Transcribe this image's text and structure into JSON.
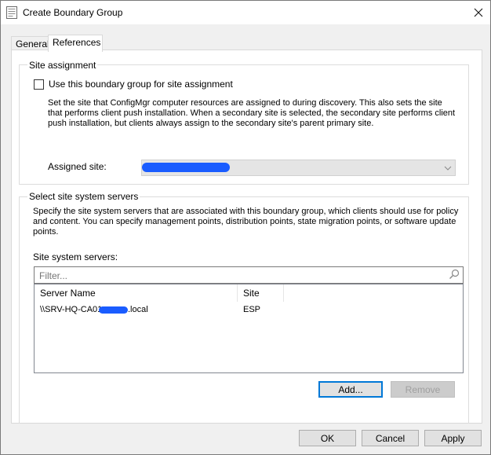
{
  "window": {
    "title": "Create Boundary Group"
  },
  "tabs": [
    {
      "label": "General"
    },
    {
      "label": "References"
    }
  ],
  "site_assignment": {
    "group_label": "Site assignment",
    "checkbox_label": "Use this boundary group for site assignment",
    "checked": false,
    "description": "Set the site that ConfigMgr computer resources are assigned to during discovery. This also sets the site that performs client push installation. When a secondary site is selected, the secondary site performs client push installation, but clients always assign to the secondary site's parent primary site.",
    "assigned_site_label": "Assigned site:",
    "assigned_site_value": ""
  },
  "site_system": {
    "group_label": "Select site system servers",
    "description": "Specify the site system servers that are associated with this boundary group, which clients should use for policy and content. You can specify management points, distribution points, state migration points, or software update points.",
    "servers_label": "Site system servers:",
    "filter_placeholder": "Filter...",
    "columns": [
      "Server Name",
      "Site"
    ],
    "rows": [
      {
        "server_prefix": "\\\\SRV-HQ-CA01",
        "server_suffix": ".local",
        "site": "ESP"
      }
    ],
    "add_label": "Add...",
    "remove_label": "Remove"
  },
  "footer": {
    "ok_label": "OK",
    "cancel_label": "Cancel",
    "apply_label": "Apply"
  },
  "colors": {
    "accent": "#0078d7",
    "redaction": "#1a5cff"
  }
}
